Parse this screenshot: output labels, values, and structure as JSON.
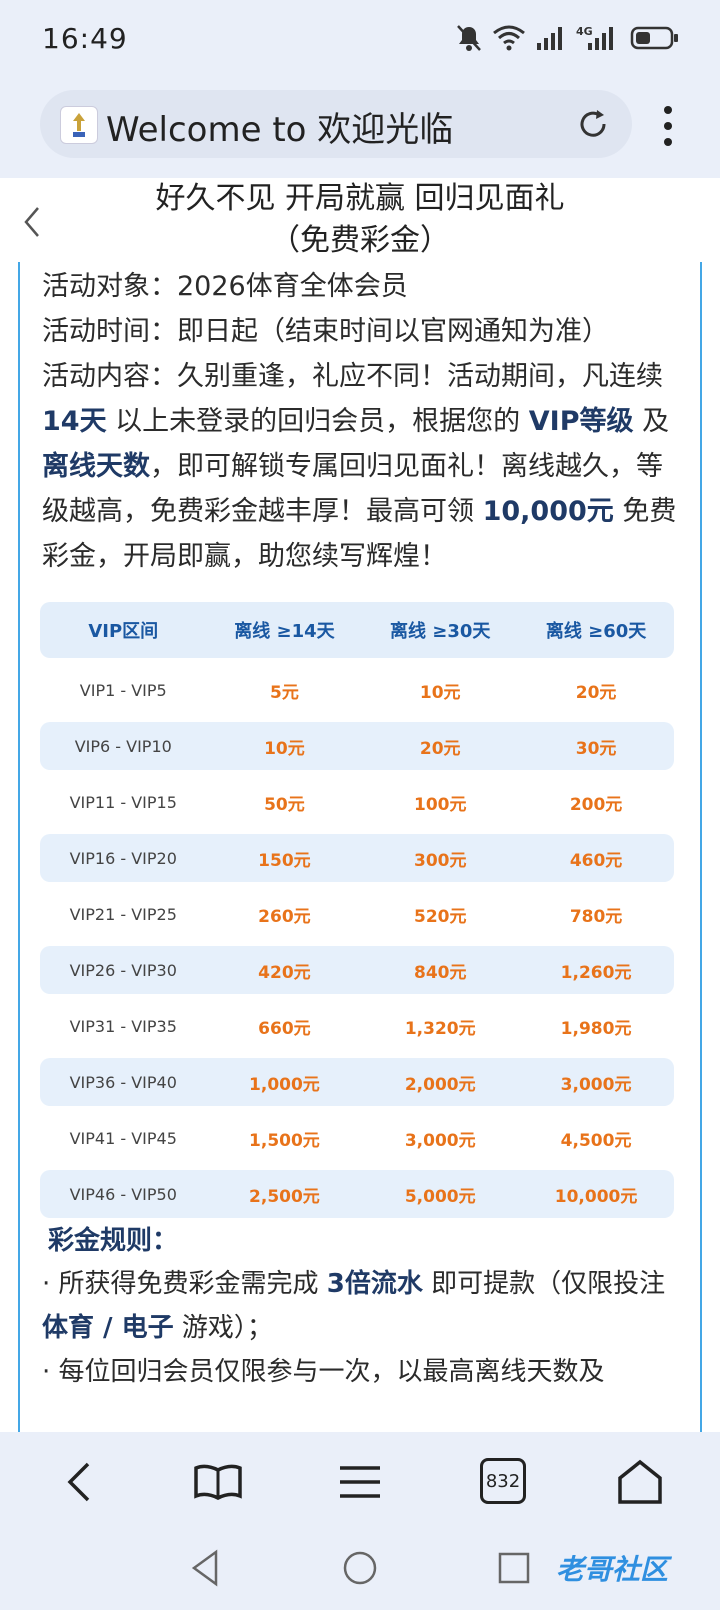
{
  "status_bar": {
    "time": "16:49",
    "network": "4G"
  },
  "browser": {
    "url_text": "Welcome to 欢迎光临",
    "tab_count": "832"
  },
  "page_header": {
    "title": "好久不见 开局就赢 回归见面礼 （免费彩金）"
  },
  "activity": {
    "target_label": "活动对象：",
    "target_value": "2026体育全体会员",
    "time_label": "活动时间：",
    "time_value": "即日起（结束时间以官网通知为准）",
    "content_label": "活动内容：",
    "content_part1": "久别重逢，礼应不同！活动期间，凡连续 ",
    "content_bold1": "14天",
    "content_part2": " 以上未登录的回归会员，根据您的 ",
    "content_bold2": "VIP等级",
    "content_part3": " 及 ",
    "content_bold3": "离线天数",
    "content_part4": "，即可解锁专属回归见面礼！离线越久，等级越高，免费彩金越丰厚！最高可领 ",
    "content_bold4": "10,000元",
    "content_part5": " 免费彩金，开局即赢，助您续写辉煌！"
  },
  "table": {
    "headers": [
      "VIP区间",
      "离线 ≥14天",
      "离线 ≥30天",
      "离线 ≥60天"
    ],
    "rows": [
      [
        "VIP1 - VIP5",
        "5元",
        "10元",
        "20元"
      ],
      [
        "VIP6 - VIP10",
        "10元",
        "20元",
        "30元"
      ],
      [
        "VIP11 - VIP15",
        "50元",
        "100元",
        "200元"
      ],
      [
        "VIP16 - VIP20",
        "150元",
        "300元",
        "460元"
      ],
      [
        "VIP21 - VIP25",
        "260元",
        "520元",
        "780元"
      ],
      [
        "VIP26 - VIP30",
        "420元",
        "840元",
        "1,260元"
      ],
      [
        "VIP31 - VIP35",
        "660元",
        "1,320元",
        "1,980元"
      ],
      [
        "VIP36 - VIP40",
        "1,000元",
        "2,000元",
        "3,000元"
      ],
      [
        "VIP41 - VIP45",
        "1,500元",
        "3,000元",
        "4,500元"
      ],
      [
        "VIP46 - VIP50",
        "2,500元",
        "5,000元",
        "10,000元"
      ]
    ]
  },
  "rules": {
    "title": "彩金规则：",
    "rule1_part1": "· 所获得免费彩金需完成 ",
    "rule1_bold1": "3倍流水",
    "rule1_part2": " 即可提款（仅限投注 ",
    "rule1_bold2": "体育 / 电子",
    "rule1_part3": " 游戏）；",
    "rule2": "· 每位回归会员仅限参与一次，以最高离线天数及"
  },
  "watermark": "老哥社区",
  "colors": {
    "accent_blue": "#1a58a2",
    "value_orange": "#e8731a",
    "frame_blue": "#44a7e6"
  }
}
